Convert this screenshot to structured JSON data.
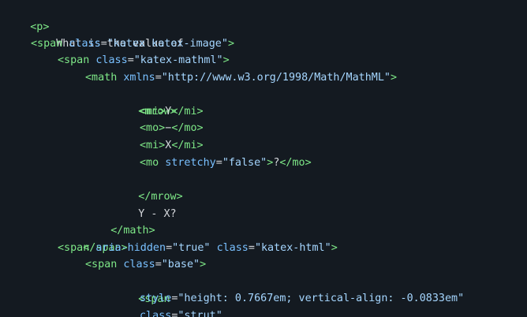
{
  "code": {
    "l1": {
      "tag": "<p>"
    },
    "l2": {
      "text": "What is the value of"
    },
    "l3": {
      "open": "<span",
      "attr": "class",
      "eq": "=",
      "val": "\"katex katex-image\"",
      "close": ">"
    },
    "l4": {
      "open": "<span",
      "attr": "class",
      "eq": "=",
      "val": "\"katex-mathml\"",
      "close": ">"
    },
    "l5": {
      "open": "<math",
      "attr": "xmlns",
      "eq": "=",
      "val": "\"http://www.w3.org/1998/Math/MathML\"",
      "close": ">"
    },
    "l6": {
      "tag": "<mrow>"
    },
    "l7": {
      "open": "<mi>",
      "text": "Y",
      "close": "</mi>"
    },
    "l8": {
      "open": "<mo>",
      "text": "−",
      "close": "</mo>"
    },
    "l9": {
      "open": "<mi>",
      "text": "X",
      "close": "</mi>"
    },
    "l10": {
      "open": "<mo",
      "attr": "stretchy",
      "eq": "=",
      "val": "\"false\"",
      "close": ">",
      "text": "?",
      "end": "</mo>"
    },
    "l11": {
      "tag": "</mrow>"
    },
    "l12": {
      "text": "Y - X?"
    },
    "l13": {
      "tag": "</math>"
    },
    "l14": {
      "tag": "</span>"
    },
    "l15": {
      "open": "<span",
      "attr1": "aria-hidden",
      "eq1": "=",
      "val1": "\"true\"",
      "attr2": "class",
      "eq2": "=",
      "val2": "\"katex-html\"",
      "close": ">"
    },
    "l16": {
      "open": "<span",
      "attr": "class",
      "eq": "=",
      "val": "\"base\"",
      "close": ">"
    },
    "l17": {
      "tag": "<span"
    },
    "l18": {
      "attr": "style",
      "eq": "=",
      "val": "\"height: 0.7667em; vertical-align: -0.0833em\""
    },
    "l19": {
      "attr": "class",
      "eq": "=",
      "val": "\"strut\""
    }
  }
}
